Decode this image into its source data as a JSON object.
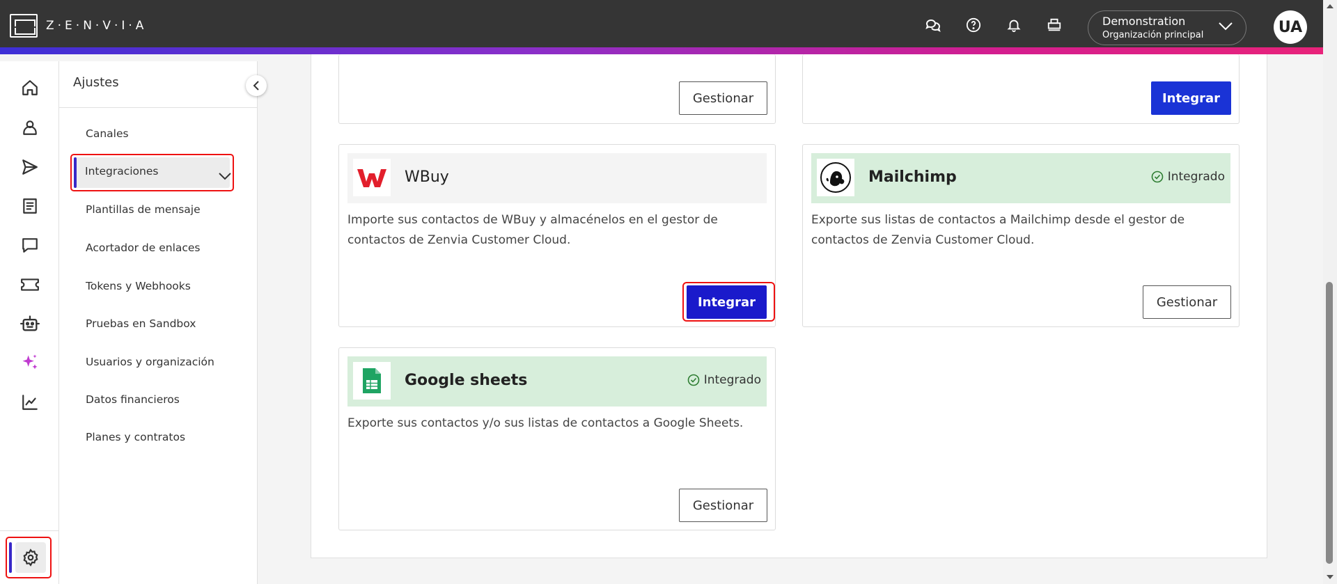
{
  "header": {
    "brand": "Z·E·N·V·I·A",
    "icons": [
      "chat-bubbles-icon",
      "help-icon",
      "bell-icon",
      "printer-icon"
    ],
    "org": {
      "name": "Demonstration",
      "sub": "Organización principal"
    },
    "avatar": "UA",
    "gradient_colors": [
      "#3d2fd6",
      "#d31e8f"
    ]
  },
  "rail": {
    "items": [
      "home-icon",
      "user-icon",
      "send-icon",
      "document-icon",
      "chat-icon",
      "ticket-icon",
      "bot-icon",
      "sparkles-icon",
      "chart-icon"
    ],
    "active": "settings-icon",
    "accent": "#3828c8"
  },
  "menu": {
    "title": "Ajustes",
    "items": [
      "Canales",
      "Integraciones",
      "Plantillas de mensaje",
      "Acortador de enlaces",
      "Tokens y Webhooks",
      "Pruebas en Sandbox",
      "Usuarios y organización",
      "Datos financieros",
      "Planes y contratos"
    ],
    "active_index": 1
  },
  "cards": {
    "top_left": {
      "button": "Gestionar"
    },
    "top_right": {
      "button": "Integrar"
    },
    "wbuy": {
      "title": "WBuy",
      "description": "Importe sus contactos de WBuy y almacénelos en el gestor de contactos de Zenvia Customer Cloud.",
      "button": "Integrar",
      "logo": "wbuy-logo"
    },
    "mailchimp": {
      "title": "Mailchimp",
      "status": "Integrado",
      "description": "Exporte sus listas de contactos a Mailchimp desde el gestor de contactos de Zenvia Customer Cloud.",
      "button": "Gestionar",
      "logo": "mailchimp-logo"
    },
    "google_sheets": {
      "title": "Google sheets",
      "status": "Integrado",
      "description": "Exporte sus contactos y/o sus listas de contactos a Google Sheets.",
      "button": "Gestionar",
      "logo": "google-sheets-logo"
    }
  },
  "colors": {
    "primary": "#1a33d6",
    "integrated_bg": "#d7eedb",
    "success": "#2e7d32",
    "highlight": "#e11111"
  }
}
